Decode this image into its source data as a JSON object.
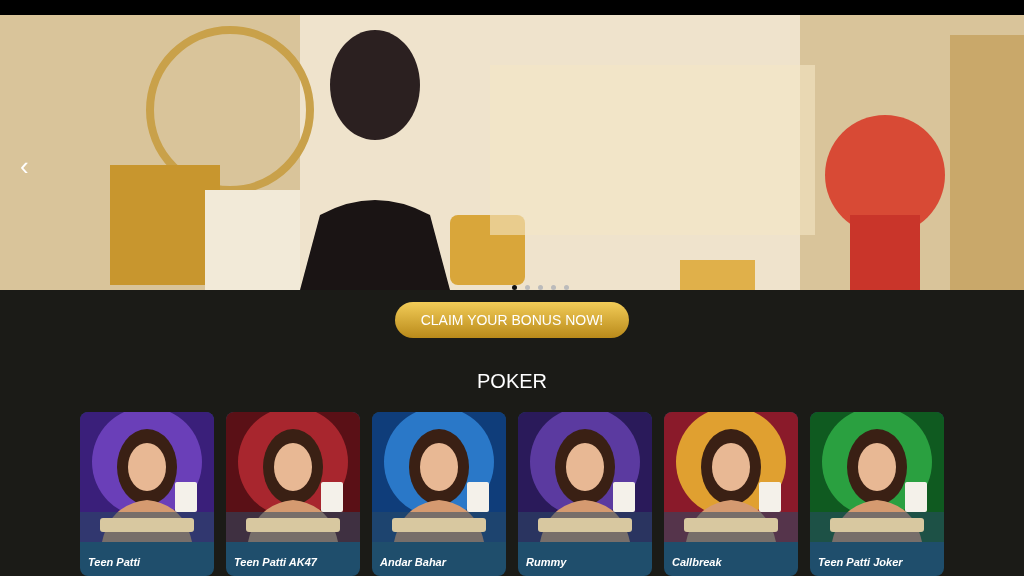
{
  "banner": {
    "prev_arrow": "‹",
    "dots": [
      {
        "selected": true
      },
      {
        "selected": false
      },
      {
        "selected": false
      },
      {
        "selected": false
      },
      {
        "selected": false
      }
    ]
  },
  "cta_button": "CLAIM YOUR BONUS NOW!",
  "section_title": "POKER",
  "games": [
    {
      "title": "Teen Patti"
    },
    {
      "title": "Teen Patti AK47"
    },
    {
      "title": "Andar Bahar"
    },
    {
      "title": "Rummy"
    },
    {
      "title": "Callbreak"
    },
    {
      "title": "Teen Patti Joker"
    }
  ]
}
